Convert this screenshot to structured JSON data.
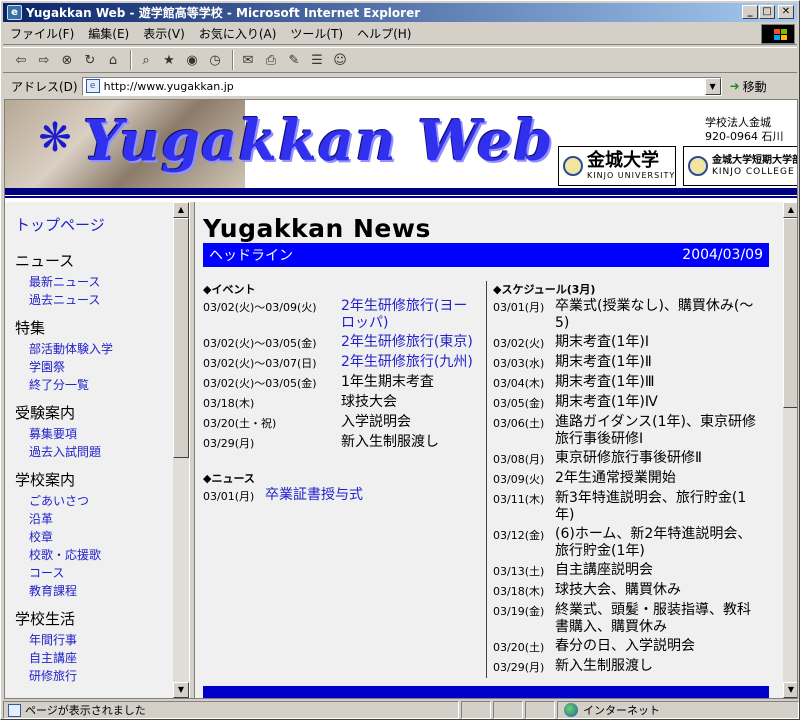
{
  "window": {
    "title": "Yugakkan Web - 遊学館高等学校 - Microsoft Internet Explorer"
  },
  "menu": [
    "ファイル(F)",
    "編集(E)",
    "表示(V)",
    "お気に入り(A)",
    "ツール(T)",
    "ヘルプ(H)"
  ],
  "address": {
    "label": "アドレス(D)",
    "url": "http://www.yugakkan.jp",
    "go_label": "移動"
  },
  "banner": {
    "title": "Yugakkan Web",
    "corp_line1": "学校法人金城",
    "corp_line2": "920-0964 石川",
    "uni1_jp": "金城大学",
    "uni1_en": "KINJO UNIVERSITY",
    "uni2_jp": "金城大学短期大学部",
    "uni2_en": "KINJO COLLEGE"
  },
  "sidebar": {
    "top": "トップページ",
    "sections": [
      {
        "title": "ニュース",
        "items": [
          "最新ニュース",
          "過去ニュース"
        ]
      },
      {
        "title": "特集",
        "items": [
          "部活動体験入学",
          "学園祭",
          "終了分一覧"
        ]
      },
      {
        "title": "受験案内",
        "items": [
          "募集要項",
          "過去入試問題"
        ]
      },
      {
        "title": "学校案内",
        "items": [
          "ごあいさつ",
          "沿革",
          "校章",
          "校歌・応援歌",
          "コース",
          "教育課程"
        ]
      },
      {
        "title": "学校生活",
        "items": [
          "年間行事",
          "自主講座",
          "研修旅行"
        ]
      }
    ]
  },
  "main": {
    "title": "Yugakkan News",
    "headline_label": "ヘッドライン",
    "date": "2004/03/09",
    "events_header": "◆イベント",
    "events": [
      {
        "date": "03/02(火)～03/09(火)",
        "text": "2年生研修旅行(ヨーロッパ)",
        "link": true
      },
      {
        "date": "03/02(火)～03/05(金)",
        "text": "2年生研修旅行(東京)",
        "link": true
      },
      {
        "date": "03/02(火)～03/07(日)",
        "text": "2年生研修旅行(九州)",
        "link": true
      },
      {
        "date": "03/02(火)～03/05(金)",
        "text": "1年生期末考査",
        "link": false
      },
      {
        "date": "03/18(木)",
        "text": "球技大会",
        "link": false
      },
      {
        "date": "03/20(土・祝)",
        "text": "入学説明会",
        "link": false
      },
      {
        "date": "03/29(月)",
        "text": "新入生制服渡し",
        "link": false
      }
    ],
    "news_header": "◆ニュース",
    "news": [
      {
        "date": "03/01(月)",
        "text": "卒業証書授与式",
        "link": true
      }
    ],
    "schedule_header": "◆スケジュール(3月)",
    "schedule": [
      {
        "date": "03/01(月)",
        "text": "卒業式(授業なし)、購買休み(～5)"
      },
      {
        "date": "03/02(火)",
        "text": "期末考査(1年)Ⅰ"
      },
      {
        "date": "03/03(水)",
        "text": "期末考査(1年)Ⅱ"
      },
      {
        "date": "03/04(木)",
        "text": "期末考査(1年)Ⅲ"
      },
      {
        "date": "03/05(金)",
        "text": "期末考査(1年)Ⅳ"
      },
      {
        "date": "03/06(土)",
        "text": "進路ガイダンス(1年)、東京研修旅行事後研修Ⅰ"
      },
      {
        "date": "03/08(月)",
        "text": "東京研修旅行事後研修Ⅱ"
      },
      {
        "date": "03/09(火)",
        "text": "2年生通常授業開始"
      },
      {
        "date": "03/11(木)",
        "text": "新3年特進説明会、旅行貯金(1年)"
      },
      {
        "date": "03/12(金)",
        "text": "(6)ホーム、新2年特進説明会、旅行貯金(1年)"
      },
      {
        "date": "03/13(土)",
        "text": "自主講座説明会"
      },
      {
        "date": "03/18(木)",
        "text": "球技大会、購買休み"
      },
      {
        "date": "03/19(金)",
        "text": "終業式、頭髪・服装指導、教科書購入、購買休み"
      },
      {
        "date": "03/20(土)",
        "text": "春分の日、入学説明会"
      },
      {
        "date": "03/29(月)",
        "text": "新入生制服渡し"
      }
    ]
  },
  "status": {
    "text": "ページが表示されました",
    "zone": "インターネット"
  },
  "colors": {
    "accent": "#0000ff",
    "navy": "#000080",
    "link": "#2222cc"
  }
}
